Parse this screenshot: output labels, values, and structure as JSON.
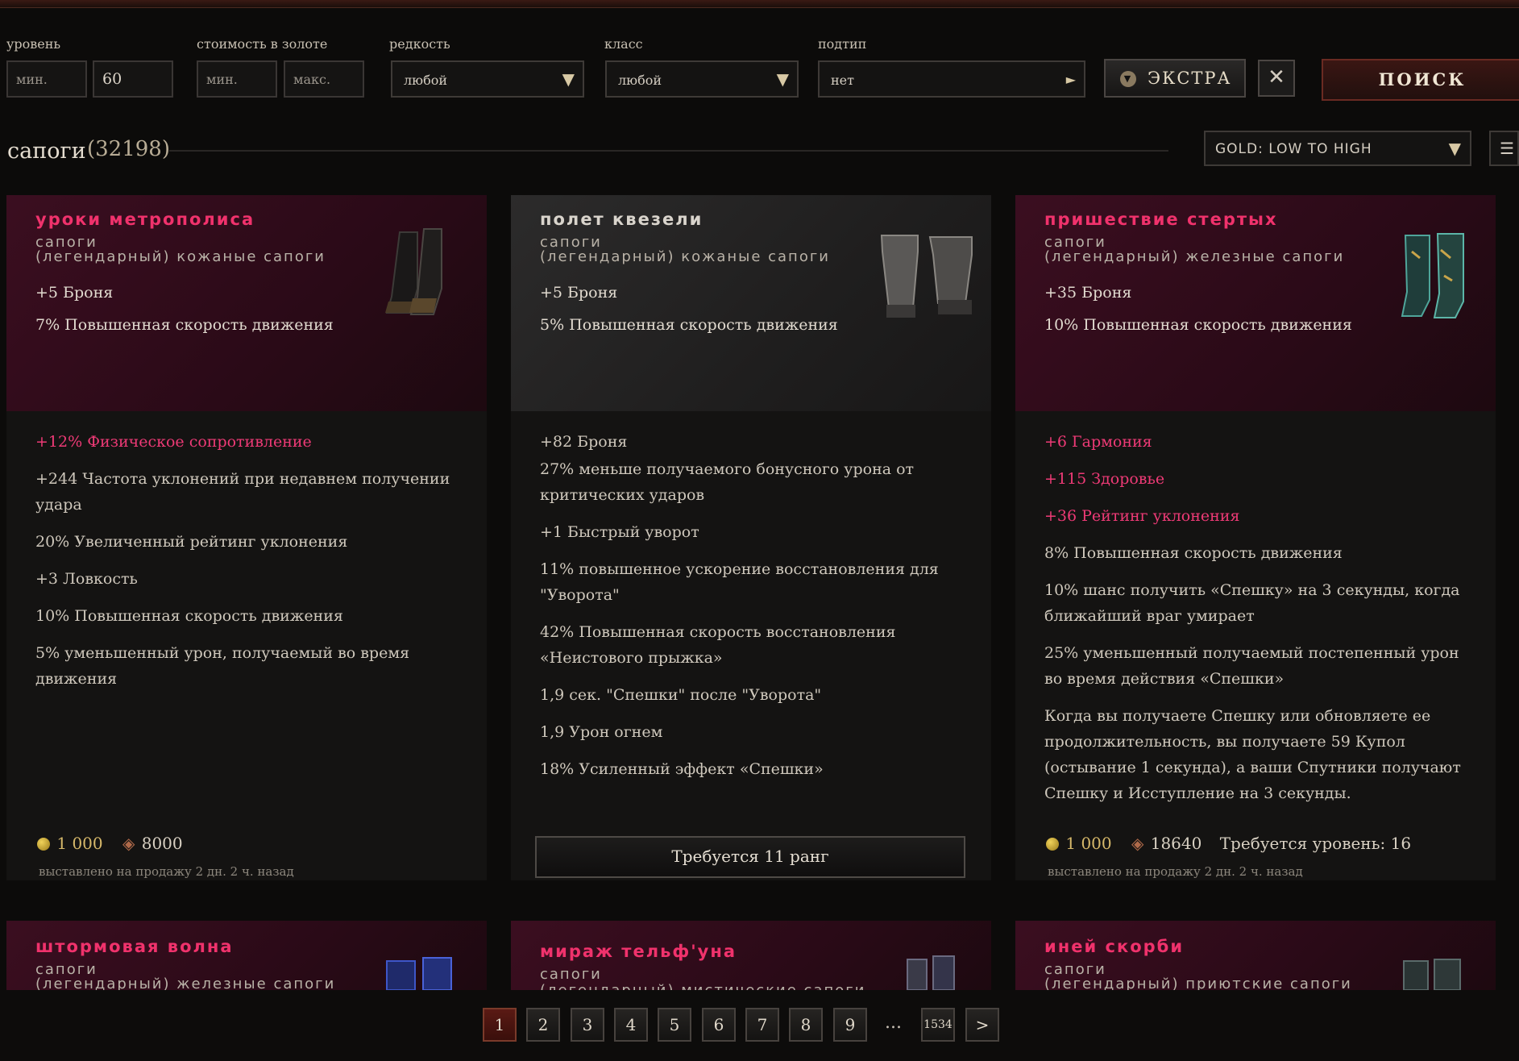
{
  "filters": {
    "level_label": "уровень",
    "level_min_placeholder": "мин.",
    "level_max_value": "60",
    "gold_label": "стоимость в золоте",
    "gold_min_placeholder": "мин.",
    "gold_max_placeholder": "макс.",
    "rarity_label": "редкость",
    "rarity_value": "любой",
    "class_label": "класс",
    "class_value": "любой",
    "subtype_label": "подтип",
    "subtype_value": "нет",
    "extra_label": "ЭКСТРА",
    "search_label": "ПОИСК",
    "clear_icon": "close-icon"
  },
  "results": {
    "title": "сапоги",
    "count": "(32198)",
    "sort_value": "GOLD: LOW TO HIGH"
  },
  "cards": [
    {
      "name": "уроки метрополиса",
      "type_line1": "сапоги",
      "type_line2": "(легендарный) кожаные сапоги",
      "implicits": [
        "+5 Броня",
        "7% Повышенная скорость движения"
      ],
      "affixes": [
        {
          "text": "+12% Физическое сопротивление",
          "highlight": true
        },
        {
          "text": "+244 Частота уклонений при недавнем получении удара",
          "highlight": false
        },
        {
          "text": "20% Увеличенный рейтинг уклонения",
          "highlight": false
        },
        {
          "text": "+3 Ловкость",
          "highlight": false
        },
        {
          "text": "10% Повышенная скорость движения",
          "highlight": false
        },
        {
          "text": "5% уменьшенный урон, получаемый во время движения",
          "highlight": false
        }
      ],
      "gold": "1 000",
      "shards": "8000",
      "listed": "выставлено на продажу 2 дн. 2 ч. назад"
    },
    {
      "name": "полет квезели",
      "type_line1": "сапоги",
      "type_line2": "(легендарный) кожаные сапоги",
      "implicits": [
        "+5 Броня",
        "5% Повышенная скорость движения"
      ],
      "affixes": [
        {
          "text": "+82 Броня",
          "highlight": false
        },
        {
          "text": "27% меньше получаемого бонусного урона от критических ударов",
          "highlight": false
        },
        {
          "text": "+1 Быстрый уворот",
          "highlight": false
        },
        {
          "text": "11% повышенное ускорение восстановления для \"Уворота\"",
          "highlight": false
        },
        {
          "text": "42% Повышенная скорость восстановления «Неистового прыжка»",
          "highlight": false
        },
        {
          "text": "1,9 сек. \"Спешки\" после \"Уворота\"",
          "highlight": false
        },
        {
          "text": "1,9 Урон огнем",
          "highlight": false
        },
        {
          "text": "18% Усиленный эффект «Спешки»",
          "highlight": false
        }
      ],
      "rank_requirement": "Требуется 11 ранг"
    },
    {
      "name": "пришествие стертых",
      "type_line1": "сапоги",
      "type_line2": "(легендарный) железные сапоги",
      "implicits": [
        "+35 Броня",
        "10% Повышенная скорость движения"
      ],
      "affixes": [
        {
          "text": "+6 Гармония",
          "highlight": true
        },
        {
          "text": "+115 Здоровье",
          "highlight": true
        },
        {
          "text": "+36 Рейтинг уклонения",
          "highlight": true
        },
        {
          "text": "8% Повышенная скорость движения",
          "highlight": false
        },
        {
          "text": "10% шанс получить «Спешку» на 3 секунды, когда ближайший враг умирает",
          "highlight": false
        },
        {
          "text": "25% уменьшенный получаемый постепенный урон во время действия «Спешки»",
          "highlight": false
        },
        {
          "text": "Когда вы получаете Спешку или обновляете ее продолжительность, вы получаете 59 Купол (остывание 1 секунда), а ваши Спутники получают Спешку и Исступление на 3 секунды.",
          "highlight": false
        }
      ],
      "gold": "1 000",
      "shards": "18640",
      "level_requirement": "Требуется уровень: 16",
      "listed": "выставлено на продажу 2 дн. 2 ч. назад"
    }
  ],
  "cards_row2": [
    {
      "name": "штормовая волна",
      "type_line1": "сапоги",
      "type_line2": "(легендарный) железные сапоги"
    },
    {
      "name": "мираж тельф'уна",
      "type_line1": "сапоги",
      "type_line2": "(легендарный) мистические сапоги"
    },
    {
      "name": "иней скорби",
      "type_line1": "сапоги",
      "type_line2": "(легендарный) приютские сапоги"
    }
  ],
  "pagination": {
    "pages": [
      "1",
      "2",
      "3",
      "4",
      "5",
      "6",
      "7",
      "8",
      "9"
    ],
    "ellipsis": "...",
    "last": "1534",
    "next": ">"
  },
  "colors": {
    "legendary_name": "#f0326c",
    "highlight_affix": "#ee3a76",
    "gold": "#d6b86a"
  }
}
